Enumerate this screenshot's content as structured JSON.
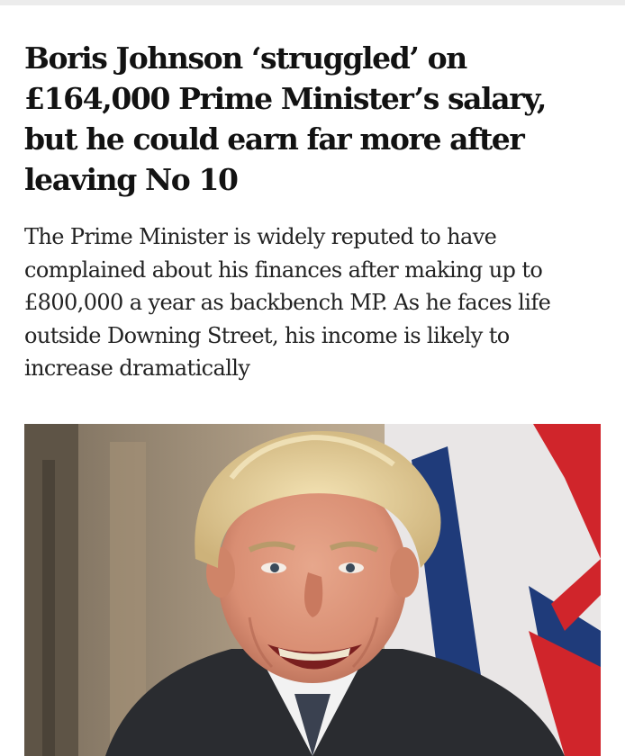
{
  "article": {
    "headline": "Boris Johnson ‘struggled’ on £164,000 Prime Minister’s salary, but he could earn far more after leaving No 10",
    "standfirst": "The Prime Minister is widely reputed to have complained about his finances after making up to £800,000 a year as backbench MP. As he faces life outside Downing Street, his income is likely to increase dramatically"
  },
  "photo": {
    "subject": "smiling man with blond hair in dark suit in front of Union flag"
  },
  "colors": {
    "text": "#121212",
    "flag_red": "#d0252b",
    "flag_blue": "#1f3b7a",
    "background": "#ffffff"
  }
}
